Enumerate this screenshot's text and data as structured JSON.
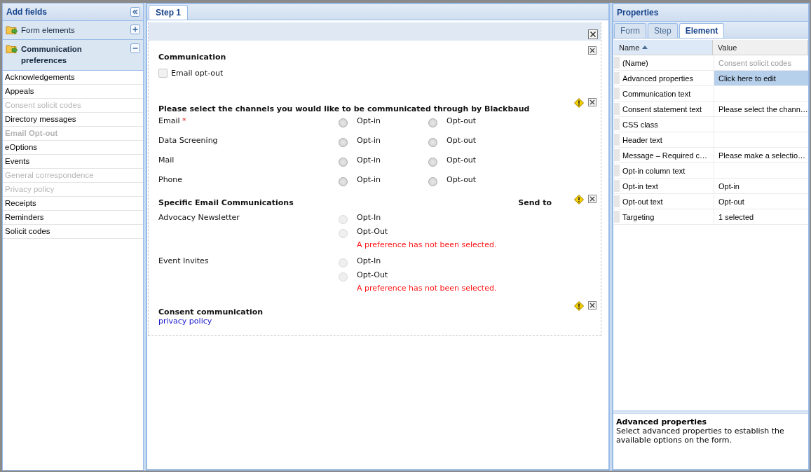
{
  "sidebar": {
    "title": "Add fields",
    "sections": [
      {
        "label": "Form elements",
        "expanded": false
      },
      {
        "label": "Communication preferences",
        "expanded": true,
        "items": [
          {
            "label": "Acknowledgements",
            "disabled": false,
            "bold": false
          },
          {
            "label": "Appeals",
            "disabled": false,
            "bold": false
          },
          {
            "label": "Consent solicit codes",
            "disabled": true,
            "bold": false
          },
          {
            "label": "Directory messages",
            "disabled": false,
            "bold": false
          },
          {
            "label": "Email Opt-out",
            "disabled": true,
            "bold": true
          },
          {
            "label": "eOptions",
            "disabled": false,
            "bold": false
          },
          {
            "label": "Events",
            "disabled": false,
            "bold": false
          },
          {
            "label": "General correspondence",
            "disabled": true,
            "bold": false
          },
          {
            "label": "Privacy policy",
            "disabled": true,
            "bold": false
          },
          {
            "label": "Receipts",
            "disabled": false,
            "bold": false
          },
          {
            "label": "Reminders",
            "disabled": false,
            "bold": false
          },
          {
            "label": "Solicit codes",
            "disabled": false,
            "bold": false
          }
        ]
      }
    ]
  },
  "form": {
    "tabs": [
      {
        "label": "Step 1",
        "selected": true
      }
    ],
    "sections": [
      {
        "kind": "checkboxes",
        "title": "Communication",
        "warning": false,
        "options": [
          {
            "label": "Email opt-out",
            "checked": false
          }
        ]
      },
      {
        "kind": "channels",
        "title": "Please select the channels you would like to be communicated through by Blackbaud",
        "warning": true,
        "rows": [
          {
            "label": "Email",
            "mark": "*",
            "options": [
              {
                "label": "Opt-in",
                "selected": false
              },
              {
                "label": "Opt-out",
                "selected": false
              }
            ]
          },
          {
            "label": "Data Screening",
            "options": [
              {
                "label": "Opt-in",
                "selected": false
              },
              {
                "label": "Opt-out",
                "selected": false
              }
            ]
          },
          {
            "label": "Mail",
            "options": [
              {
                "label": "Opt-in",
                "selected": false
              },
              {
                "label": "Opt-out",
                "selected": false
              }
            ]
          },
          {
            "label": "Phone",
            "options": [
              {
                "label": "Opt-in",
                "selected": false
              },
              {
                "label": "Opt-out",
                "selected": false
              }
            ]
          }
        ]
      },
      {
        "kind": "specific",
        "title": "Specific Email Communications",
        "aside": "Send to",
        "warning": true,
        "rows": [
          {
            "label": "Advocacy Newsletter",
            "options": [
              {
                "label": "Opt-In",
                "selected": false,
                "disabled": true
              },
              {
                "label": "Opt-Out",
                "selected": false,
                "disabled": true
              }
            ],
            "error": "A preference has not been selected."
          },
          {
            "label": "Event Invites",
            "options": [
              {
                "label": "Opt-In",
                "selected": false,
                "disabled": true
              },
              {
                "label": "Opt-Out",
                "selected": false,
                "disabled": true
              }
            ],
            "error": "A preference has not been selected."
          }
        ]
      },
      {
        "kind": "consent",
        "title": "Consent communication",
        "warning": true,
        "link": "privacy policy"
      }
    ]
  },
  "properties": {
    "title": "Properties",
    "tabs": [
      {
        "label": "Form",
        "selected": false
      },
      {
        "label": "Step",
        "selected": false
      },
      {
        "label": "Element",
        "selected": true
      }
    ],
    "columns": [
      {
        "label": "Name",
        "sorted": true
      },
      {
        "label": "Value",
        "sorted": false
      }
    ],
    "rows": [
      {
        "name": "(Name)",
        "value": "Consent solicit codes",
        "muted": true,
        "selected": false
      },
      {
        "name": "Advanced properties",
        "value": "Click here to edit",
        "muted": false,
        "selected": true
      },
      {
        "name": "Communication text",
        "selected": false
      },
      {
        "name": "Consent statement text",
        "value": "Please select the chann…",
        "muted": false,
        "selected": false
      },
      {
        "name": "CSS class",
        "selected": false
      },
      {
        "name": "Header text",
        "selected": false
      },
      {
        "name": "Message – Required c…",
        "value": "Please make a selectio…",
        "muted": false,
        "selected": false
      },
      {
        "name": "Opt-in column text",
        "selected": false
      },
      {
        "name": "Opt-in text",
        "value": "Opt-in",
        "muted": false,
        "selected": false
      },
      {
        "name": "Opt-out text",
        "value": "Opt-out",
        "muted": false,
        "selected": false
      },
      {
        "name": "Targeting",
        "value": "1 selected",
        "muted": false,
        "selected": false
      }
    ],
    "description": {
      "title": "Advanced properties",
      "text": "Select advanced properties to establish the available options on the form."
    }
  }
}
